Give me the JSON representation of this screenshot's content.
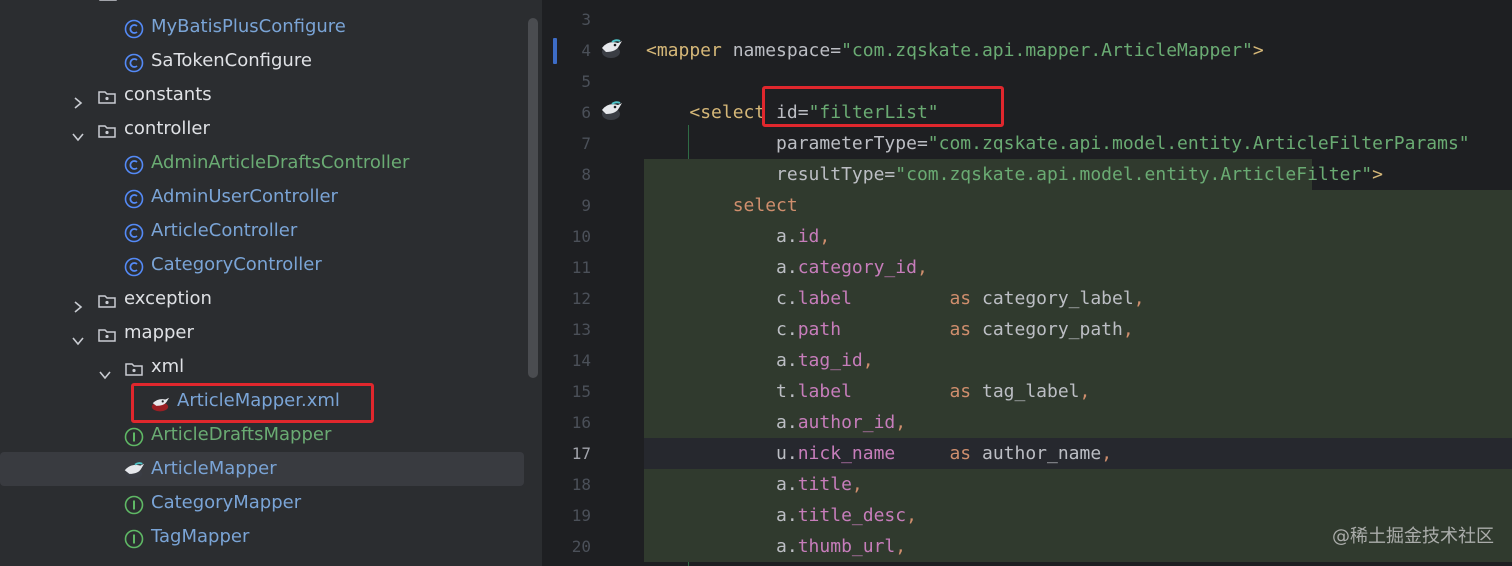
{
  "tree": {
    "items": [
      {
        "label": "MyBatisPlusConfigure",
        "kind": "class-icon",
        "color": "blue"
      },
      {
        "label": "SaTokenConfigure",
        "kind": "class-icon",
        "color": "white"
      },
      {
        "label": "constants",
        "kind": "folder-icon",
        "state": "collapsed"
      },
      {
        "label": "controller",
        "kind": "folder-icon",
        "state": "expanded"
      },
      {
        "label": "AdminArticleDraftsController",
        "kind": "class-icon",
        "color": "green"
      },
      {
        "label": "AdminUserController",
        "kind": "class-icon",
        "color": "blue"
      },
      {
        "label": "ArticleController",
        "kind": "class-icon",
        "color": "blue"
      },
      {
        "label": "CategoryController",
        "kind": "class-icon",
        "color": "blue"
      },
      {
        "label": "exception",
        "kind": "folder-icon",
        "state": "collapsed"
      },
      {
        "label": "mapper",
        "kind": "folder-icon",
        "state": "expanded"
      },
      {
        "label": "xml",
        "kind": "folder-icon",
        "state": "expanded"
      },
      {
        "label": "ArticleMapper.xml",
        "kind": "mybatis-xml-icon",
        "color": "blue"
      },
      {
        "label": "ArticleDraftsMapper",
        "kind": "interface-icon",
        "color": "green"
      },
      {
        "label": "ArticleMapper",
        "kind": "mybatis-bird-icon",
        "color": "blue",
        "selected": true
      },
      {
        "label": "CategoryMapper",
        "kind": "interface-icon",
        "color": "blue"
      },
      {
        "label": "TagMapper",
        "kind": "interface-icon",
        "color": "blue"
      }
    ]
  },
  "editor": {
    "current_line": "17",
    "lines": [
      {
        "n": "3",
        "tokens": []
      },
      {
        "n": "4",
        "tokens": [
          [
            "t-tag",
            "<mapper "
          ],
          [
            "t-attr",
            "namespace"
          ],
          [
            "t-txt",
            "="
          ],
          [
            "t-str",
            "\"com.zqskate.api.mapper.ArticleMapper\""
          ],
          [
            "t-tag",
            ">"
          ]
        ]
      },
      {
        "n": "5",
        "tokens": []
      },
      {
        "n": "6",
        "tokens": [
          [
            "t-txt",
            "    "
          ],
          [
            "t-tag",
            "<select "
          ],
          [
            "t-attr",
            "id"
          ],
          [
            "t-txt",
            "="
          ],
          [
            "t-str",
            "\"filterList\""
          ]
        ]
      },
      {
        "n": "7",
        "tokens": [
          [
            "t-txt",
            "            "
          ],
          [
            "t-attr",
            "parameterType"
          ],
          [
            "t-txt",
            "="
          ],
          [
            "t-str",
            "\"com.zqskate.api.model.entity.ArticleFilterParams\""
          ]
        ]
      },
      {
        "n": "8",
        "tokens": [
          [
            "t-txt",
            "            "
          ],
          [
            "t-attr",
            "resultType"
          ],
          [
            "t-txt",
            "="
          ],
          [
            "t-str",
            "\"com.zqskate.api.model.entity.ArticleFilter\""
          ],
          [
            "t-tag",
            ">"
          ]
        ]
      },
      {
        "n": "9",
        "tokens": [
          [
            "t-txt",
            "        "
          ],
          [
            "t-kw",
            "select"
          ]
        ]
      },
      {
        "n": "10",
        "tokens": [
          [
            "t-txt",
            "            a."
          ],
          [
            "t-fld",
            "id"
          ],
          [
            "t-kw",
            ","
          ]
        ]
      },
      {
        "n": "11",
        "tokens": [
          [
            "t-txt",
            "            a."
          ],
          [
            "t-fld",
            "category_id"
          ],
          [
            "t-kw",
            ","
          ]
        ]
      },
      {
        "n": "12",
        "tokens": [
          [
            "t-txt",
            "            c."
          ],
          [
            "t-fld",
            "label"
          ],
          [
            "t-txt",
            "         "
          ],
          [
            "t-kw",
            "as"
          ],
          [
            "t-txt",
            " category_label"
          ],
          [
            "t-kw",
            ","
          ]
        ]
      },
      {
        "n": "13",
        "tokens": [
          [
            "t-txt",
            "            c."
          ],
          [
            "t-fld",
            "path"
          ],
          [
            "t-txt",
            "          "
          ],
          [
            "t-kw",
            "as"
          ],
          [
            "t-txt",
            " category_path"
          ],
          [
            "t-kw",
            ","
          ]
        ]
      },
      {
        "n": "14",
        "tokens": [
          [
            "t-txt",
            "            a."
          ],
          [
            "t-fld",
            "tag_id"
          ],
          [
            "t-kw",
            ","
          ]
        ]
      },
      {
        "n": "15",
        "tokens": [
          [
            "t-txt",
            "            t."
          ],
          [
            "t-fld",
            "label"
          ],
          [
            "t-txt",
            "         "
          ],
          [
            "t-kw",
            "as"
          ],
          [
            "t-txt",
            " tag_label"
          ],
          [
            "t-kw",
            ","
          ]
        ]
      },
      {
        "n": "16",
        "tokens": [
          [
            "t-txt",
            "            a."
          ],
          [
            "t-fld",
            "author_id"
          ],
          [
            "t-kw",
            ","
          ]
        ]
      },
      {
        "n": "17",
        "tokens": [
          [
            "t-txt",
            "            u."
          ],
          [
            "t-fld",
            "nick_name"
          ],
          [
            "t-txt",
            "     "
          ],
          [
            "t-kw",
            "as"
          ],
          [
            "t-txt",
            " author_name"
          ],
          [
            "t-kw",
            ","
          ]
        ]
      },
      {
        "n": "18",
        "tokens": [
          [
            "t-txt",
            "            a."
          ],
          [
            "t-fld",
            "title"
          ],
          [
            "t-kw",
            ","
          ]
        ]
      },
      {
        "n": "19",
        "tokens": [
          [
            "t-txt",
            "            a."
          ],
          [
            "t-fld",
            "title_desc"
          ],
          [
            "t-kw",
            ","
          ]
        ]
      },
      {
        "n": "20",
        "tokens": [
          [
            "t-txt",
            "            a."
          ],
          [
            "t-fld",
            "thumb_url"
          ],
          [
            "t-kw",
            ","
          ]
        ]
      }
    ]
  },
  "watermark": "@稀土掘金技术社区",
  "colors": {
    "highlight_box": "#e0272d",
    "selection_bg": "#303a2e",
    "tree_bg": "#2b2d30",
    "editor_bg": "#1e1f22"
  }
}
